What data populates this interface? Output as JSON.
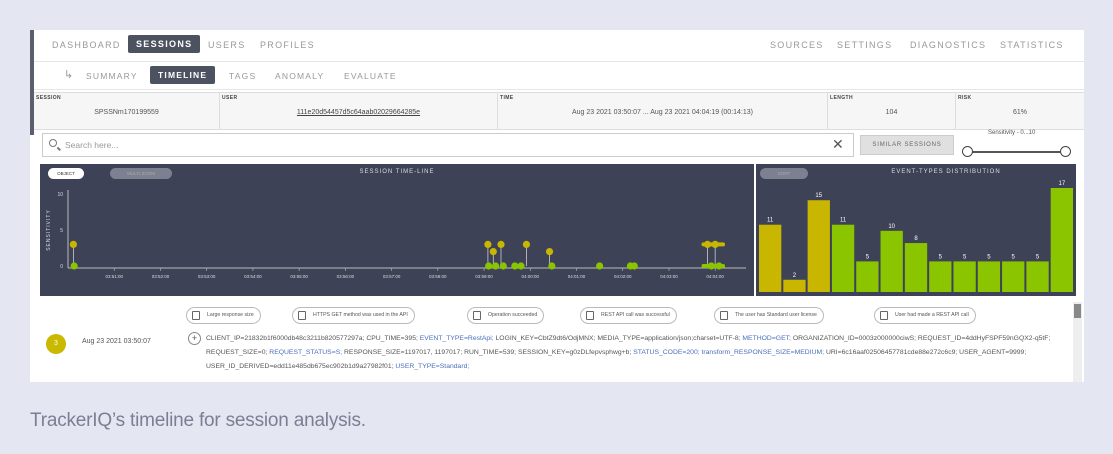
{
  "nav": {
    "left": [
      "DASHBOARD",
      "SESSIONS",
      "USERS",
      "PROFILES"
    ],
    "active": "SESSIONS",
    "right": [
      "SOURCES",
      "SETTINGS",
      "DIAGNOSTICS",
      "STATISTICS"
    ]
  },
  "subnav": {
    "items": [
      "SUMMARY",
      "TIMELINE",
      "TAGS",
      "ANOMALY",
      "EVALUATE"
    ],
    "active": "TIMELINE"
  },
  "session_info": {
    "session_label": "SESSION",
    "session_value": "SPSSNm170199559",
    "user_label": "USER",
    "user_value": "111e20d54457d5c64aab02029664285e",
    "time_label": "TIME",
    "time_value": "Aug 23 2021 03:50:07 ... Aug 23 2021 04:04:19 (00:14:13)",
    "length_label": "LENGTH",
    "length_value": "104",
    "risk_label": "RISK",
    "risk_value": "61%"
  },
  "search": {
    "placeholder": "Search here..."
  },
  "similar_sessions_label": "SIMILAR SESSIONS",
  "sensitivity_label": "Sensitivity - 0...10",
  "timeline_panel": {
    "title": "SESSION TIME-LINE",
    "toggle_on": "OBJECT",
    "toggle_off": "MULTI ZOOM",
    "y_axis_label": "SENSITIVITY",
    "y_ticks": [
      "10",
      "5",
      "0"
    ],
    "x_ticks": [
      "03:51:00",
      "03:52:00",
      "03:53:00",
      "03:54:00",
      "03:55:00",
      "03:56:00",
      "03:57:00",
      "03:58:00",
      "03:59:00",
      "04:00:00",
      "04:01:00",
      "04:02:00",
      "04:03:00",
      "04:04:00"
    ]
  },
  "distribution_panel": {
    "title": "EVENT-TYPES DISTRIBUTION",
    "toggle": "SORT"
  },
  "chart_data": [
    {
      "type": "scatter",
      "title": "SESSION TIME-LINE",
      "ylabel": "SENSITIVITY",
      "ylim": [
        0,
        10
      ],
      "x_ticks": [
        "03:51:00",
        "03:52:00",
        "03:53:00",
        "03:54:00",
        "03:55:00",
        "03:56:00",
        "03:57:00",
        "03:58:00",
        "03:59:00",
        "04:00:00",
        "04:01:00",
        "04:02:00",
        "04:03:00",
        "04:04:00"
      ],
      "points": [
        {
          "x": "03:50:07",
          "y": 3
        },
        {
          "x": "03:50:08",
          "y": 0
        },
        {
          "x": "03:59:05",
          "y": 3
        },
        {
          "x": "03:59:06",
          "y": 0
        },
        {
          "x": "03:59:12",
          "y": 2
        },
        {
          "x": "03:59:15",
          "y": 0
        },
        {
          "x": "03:59:22",
          "y": 3
        },
        {
          "x": "03:59:25",
          "y": 0
        },
        {
          "x": "03:59:40",
          "y": 0
        },
        {
          "x": "03:59:48",
          "y": 0
        },
        {
          "x": "03:59:55",
          "y": 3
        },
        {
          "x": "04:00:25",
          "y": 2
        },
        {
          "x": "04:00:28",
          "y": 0
        },
        {
          "x": "04:01:30",
          "y": 0
        },
        {
          "x": "04:02:10",
          "y": 0
        },
        {
          "x": "04:02:15",
          "y": 0
        },
        {
          "x": "04:03:50",
          "y": 3
        },
        {
          "x": "04:03:55",
          "y": 0
        },
        {
          "x": "04:04:00",
          "y": 3
        },
        {
          "x": "04:04:05",
          "y": 0
        }
      ]
    },
    {
      "type": "bar",
      "title": "EVENT-TYPES DISTRIBUTION",
      "values": [
        11,
        2,
        15,
        11,
        5,
        10,
        8,
        5,
        5,
        5,
        5,
        5,
        17
      ],
      "colors": [
        "#c8b600",
        "#c8b600",
        "#c8b600",
        "#8bc500",
        "#8bc500",
        "#8bc500",
        "#8bc500",
        "#8bc500",
        "#8bc500",
        "#8bc500",
        "#8bc500",
        "#8bc500",
        "#8bc500"
      ],
      "ylim": [
        0,
        17
      ]
    }
  ],
  "event_row": {
    "number": "3",
    "time": "Aug 23 2021 03:50:07",
    "tags": [
      "Large response size",
      "HTTPS GET method was used in the API",
      "Operation succeeded",
      "REST API call was successful",
      "The user has Standard user license",
      "User had made a REST API call"
    ],
    "plus": "+",
    "attributes": [
      {
        "k": "CLIENT_IP",
        "v": "21832b1f6000db48c3211b820577297a",
        "hl": false
      },
      {
        "k": "CPU_TIME",
        "v": "395",
        "hl": false
      },
      {
        "k": "EVENT_TYPE",
        "v": "RestApi",
        "hl": true
      },
      {
        "k": "LOGIN_KEY",
        "v": "CbtZ9dt6/OdjMNX",
        "hl": false
      },
      {
        "k": "MEDIA_TYPE",
        "v": "application/json;charset=UTF-8",
        "hl": false
      },
      {
        "k": "METHOD",
        "v": "GET",
        "hl": true
      },
      {
        "k": "ORGANIZATION_ID",
        "v": "0003z000000ciwS",
        "hl": false
      },
      {
        "k": "REQUEST_ID",
        "v": "4ddHyFSPF59nGQX2-q5tF",
        "hl": false
      },
      {
        "k": "REQUEST_SIZE",
        "v": "0",
        "hl": false
      },
      {
        "k": "REQUEST_STATUS",
        "v": "S",
        "hl": true
      },
      {
        "k": "RESPONSE_SIZE",
        "v": "1197017, 1197017",
        "hl": false
      },
      {
        "k": "RUN_TIME",
        "v": "539",
        "hl": false
      },
      {
        "k": "SESSION_KEY",
        "v": "g0zDLfepvsphwg+b",
        "hl": false
      },
      {
        "k": "STATUS_CODE",
        "v": "200",
        "hl": true
      },
      {
        "k": "transform_RESPONSE_SIZE",
        "v": "MEDIUM",
        "hl": true
      },
      {
        "k": "URI",
        "v": "6c16aaf02506457781cde88e272c6c9",
        "hl": false
      },
      {
        "k": "USER_AGENT",
        "v": "9999",
        "hl": false
      },
      {
        "k": "USER_ID_DERIVED",
        "v": "edd11e485db675ec902b1d9a27982f01",
        "hl": false
      },
      {
        "k": "USER_TYPE",
        "v": "Standard",
        "hl": true
      }
    ]
  },
  "caption": "TrackerIQ’s timeline for session analysis."
}
